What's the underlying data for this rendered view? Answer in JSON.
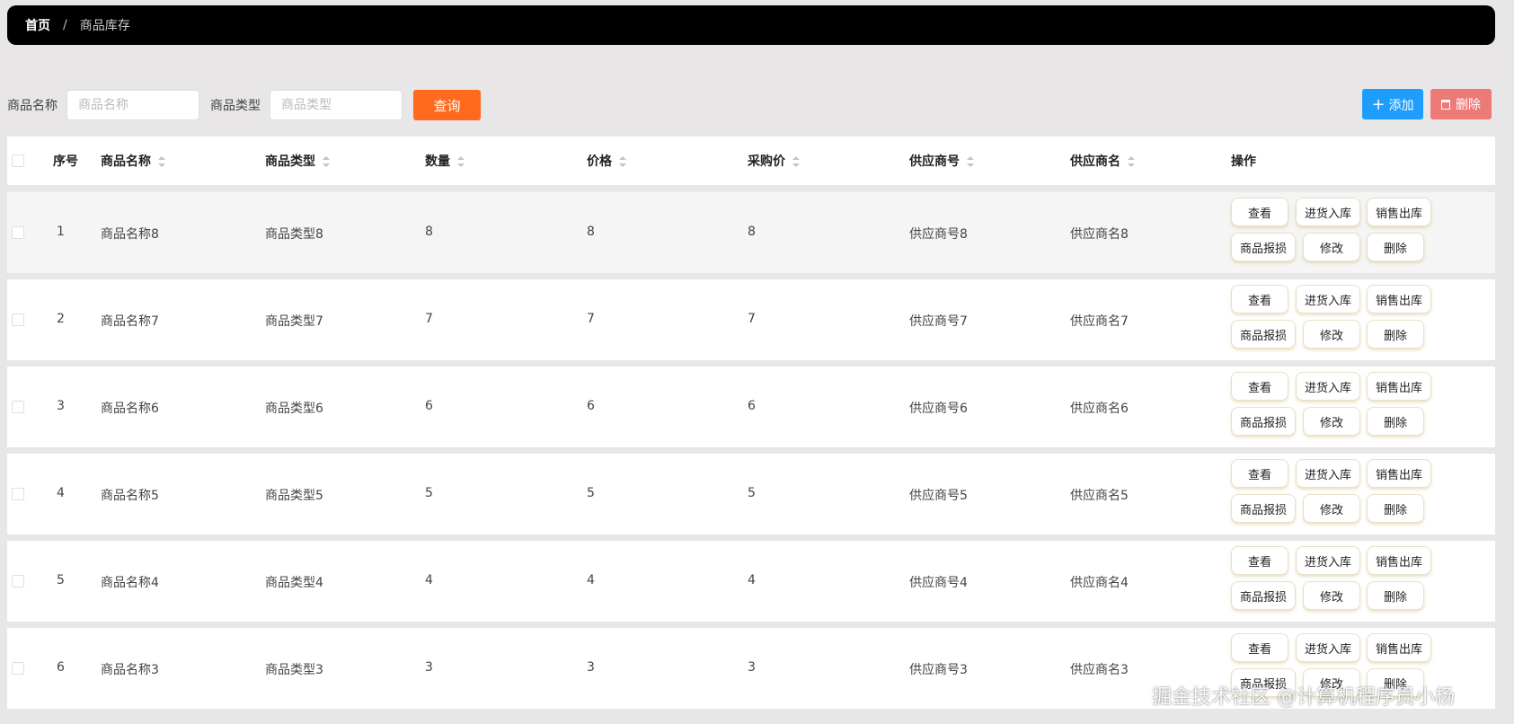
{
  "breadcrumb": {
    "home": "首页",
    "separator": "/",
    "current": "商品库存"
  },
  "search": {
    "name_label": "商品名称",
    "name_placeholder": "商品名称",
    "type_label": "商品类型",
    "type_placeholder": "商品类型",
    "query_button": "查询"
  },
  "toolbar": {
    "add_label": "添加",
    "delete_label": "删除"
  },
  "table": {
    "headers": {
      "index": "序号",
      "name": "商品名称",
      "type": "商品类型",
      "qty": "数量",
      "price": "价格",
      "purchase_price": "采购价",
      "supplier_no": "供应商号",
      "supplier_name": "供应商名",
      "actions": "操作"
    },
    "action_labels": {
      "view": "查看",
      "stock_in": "进货入库",
      "sale_out": "销售出库",
      "loss": "商品报损",
      "edit": "修改",
      "delete": "删除"
    },
    "rows": [
      {
        "index": "1",
        "name": "商品名称8",
        "type": "商品类型8",
        "qty": "8",
        "price": "8",
        "purchase_price": "8",
        "supplier_no": "供应商号8",
        "supplier_name": "供应商名8"
      },
      {
        "index": "2",
        "name": "商品名称7",
        "type": "商品类型7",
        "qty": "7",
        "price": "7",
        "purchase_price": "7",
        "supplier_no": "供应商号7",
        "supplier_name": "供应商名7"
      },
      {
        "index": "3",
        "name": "商品名称6",
        "type": "商品类型6",
        "qty": "6",
        "price": "6",
        "purchase_price": "6",
        "supplier_no": "供应商号6",
        "supplier_name": "供应商名6"
      },
      {
        "index": "4",
        "name": "商品名称5",
        "type": "商品类型5",
        "qty": "5",
        "price": "5",
        "purchase_price": "5",
        "supplier_no": "供应商号5",
        "supplier_name": "供应商名5"
      },
      {
        "index": "5",
        "name": "商品名称4",
        "type": "商品类型4",
        "qty": "4",
        "price": "4",
        "purchase_price": "4",
        "supplier_no": "供应商号4",
        "supplier_name": "供应商名4"
      },
      {
        "index": "6",
        "name": "商品名称3",
        "type": "商品类型3",
        "qty": "3",
        "price": "3",
        "purchase_price": "3",
        "supplier_no": "供应商号3",
        "supplier_name": "供应商名3"
      }
    ]
  },
  "watermark": "掘金技术社区 @计算机程序员小杨",
  "colors": {
    "query": "#ff6a1f",
    "add": "#1e9dfc",
    "delete": "#ec7a76"
  }
}
